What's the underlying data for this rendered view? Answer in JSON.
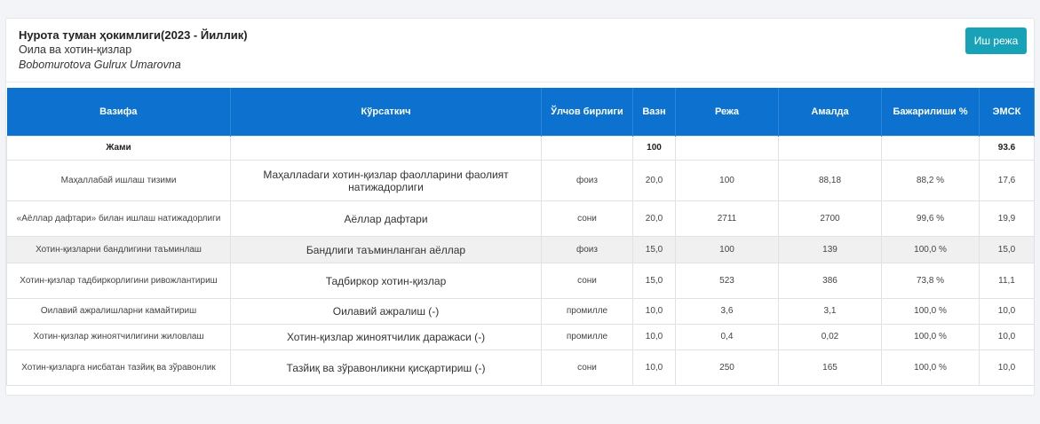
{
  "header": {
    "title": "Нурота туман ҳокимлиги(2023 - Йиллик)",
    "subtitle": "Оила ва хотин-қизлар",
    "person": "Bobomurotova Gulrux Umarovna",
    "plan_button": "Иш режа"
  },
  "table": {
    "columns": [
      "Вазифа",
      "Кўрсаткич",
      "Ўлчов бирлиги",
      "Вазн",
      "Режа",
      "Амалда",
      "Бажарилиши %",
      "ЭМСК"
    ],
    "total": {
      "label": "Жами",
      "weight": "100",
      "emsk": "93.6"
    },
    "rows": [
      {
        "task": "Маҳаллабай ишлаш тизими",
        "indicator": "Маҳаллadаги хотин-қизлар фаолларини фаолият натижадорлиги",
        "unit": "фоиз",
        "weight": "20,0",
        "plan": "100",
        "actual": "88,18",
        "percent": "88,2 %",
        "emsk": "17,6"
      },
      {
        "task": "«Аёллар дафтари» билан ишлаш натижадорлиги",
        "indicator": "Аёллар дафтари",
        "unit": "сони",
        "weight": "20,0",
        "plan": "2711",
        "actual": "2700",
        "percent": "99,6 %",
        "emsk": "19,9"
      },
      {
        "task": "Хотин-қизларни бандлигини таъминлаш",
        "indicator": "Бандлиги таъминланган аёллар",
        "unit": "фоиз",
        "weight": "15,0",
        "plan": "100",
        "actual": "139",
        "percent": "100,0 %",
        "emsk": "15,0"
      },
      {
        "task": "Хотин-қизлар тадбиркорлигини ривожлантириш",
        "indicator": "Тадбиркор хотин-қизлар",
        "unit": "сони",
        "weight": "15,0",
        "plan": "523",
        "actual": "386",
        "percent": "73,8 %",
        "emsk": "11,1"
      },
      {
        "task": "Оилавий ажралишларни камайтириш",
        "indicator": "Оилавий ажралиш (-)",
        "unit": "промилле",
        "weight": "10,0",
        "plan": "3,6",
        "actual": "3,1",
        "percent": "100,0 %",
        "emsk": "10,0"
      },
      {
        "task": "Хотин-қизлар жиноятчилигини жиловлаш",
        "indicator": "Хотин-қизлар жиноятчилик даражаси (-)",
        "unit": "промилле",
        "weight": "10,0",
        "plan": "0,4",
        "actual": "0,02",
        "percent": "100,0 %",
        "emsk": "10,0"
      },
      {
        "task": "Хотин-қизларга нисбатан тазйиқ ва зўравонлик",
        "indicator": "Тазйиқ ва зўравонликни қисқартириш (-)",
        "unit": "сони",
        "weight": "10,0",
        "plan": "250",
        "actual": "165",
        "percent": "100,0 %",
        "emsk": "10,0"
      }
    ]
  },
  "colors": {
    "header_bg": "#0d72cf",
    "button_bg": "#17a2b8",
    "highlight_row": "#f0f0f0"
  }
}
